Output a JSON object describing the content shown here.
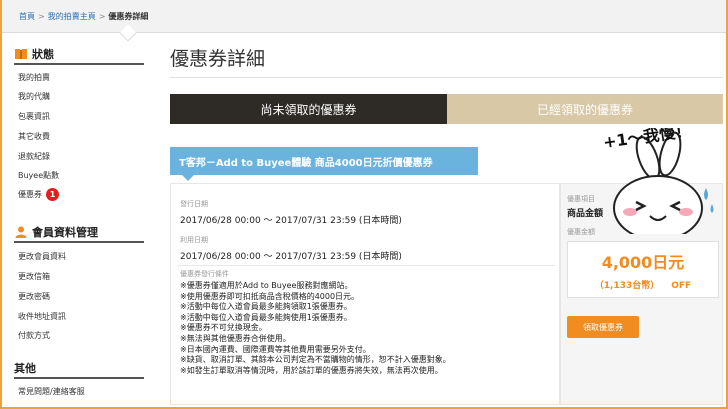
{
  "breadcrumb": {
    "home": "首頁",
    "sep": ">",
    "mypage": "我的拍賣主頁",
    "current": "優惠券詳細"
  },
  "sidebar": {
    "status_title": "狀態",
    "status_items": [
      "我的拍賣",
      "我的代購",
      "包裹資訊",
      "其它收費",
      "退款紀錄",
      "Buyee點數",
      "優惠券"
    ],
    "coupon_badge": "1",
    "member_title": "會員資料管理",
    "member_items": [
      "更改會員資料",
      "更改信箱",
      "更改密碼",
      "收件地址資訊",
      "付款方式"
    ],
    "other_title": "其他",
    "other_items": [
      "常見問題/連絡客服"
    ]
  },
  "main": {
    "title": "優惠券詳細",
    "tab_unclaimed": "尚未領取的優惠券",
    "tab_claimed": "已經領取的優惠券",
    "coupon_name": "T客邦－Add to Buyee體驗 商品4000日元折價優惠券",
    "issue_label": "發行日期",
    "issue_value": "2017/06/28 00:00 ～ 2017/07/31 23:59 (日本時間)",
    "use_label": "利用日期",
    "use_value": "2017/06/28 00:00 ～ 2017/07/31 23:59 (日本時間)",
    "cond_label": "優惠券發行條件",
    "conditions": [
      "※優惠券僅適用於Add to Buyee服務對應網站。",
      "※使用優惠券即可扣抵商品含稅價格的4000日元。",
      "※活動中每位入道會員最多能夠領取1張優惠券。",
      "※活動中每位入道會員最多能夠使用1張優惠券。",
      "※優惠券不可兌換現金。",
      "※無法與其他優惠券合併使用。",
      "※日本國內運費、國際運費等其他費用需要另外支付。",
      "※缺貨、取消訂單、其餘本公司判定為不當購物的情形，恕不計入優惠對象。",
      "※如發生訂單取消等情況時，用於該訂單的優惠券將失效，無法再次使用。"
    ],
    "item_label": "優惠項目",
    "item_value": "商品金額",
    "amount_label": "優惠金額",
    "amount_value": "4,000日元",
    "amount_twd": "（1,133台幣）",
    "amount_off": "OFF",
    "claim_button": "領取優惠券",
    "sticker_text": "+1～我慢！"
  },
  "colors": {
    "accent": "#f08c20",
    "tab_dark": "#2e2a26",
    "tab_light": "#d8c8a6",
    "coupon_blue": "#6ab3de",
    "badge_red": "#e02020",
    "link_blue": "#2a6db0"
  },
  "icons": {
    "status": "book-icon",
    "member": "person-icon"
  }
}
